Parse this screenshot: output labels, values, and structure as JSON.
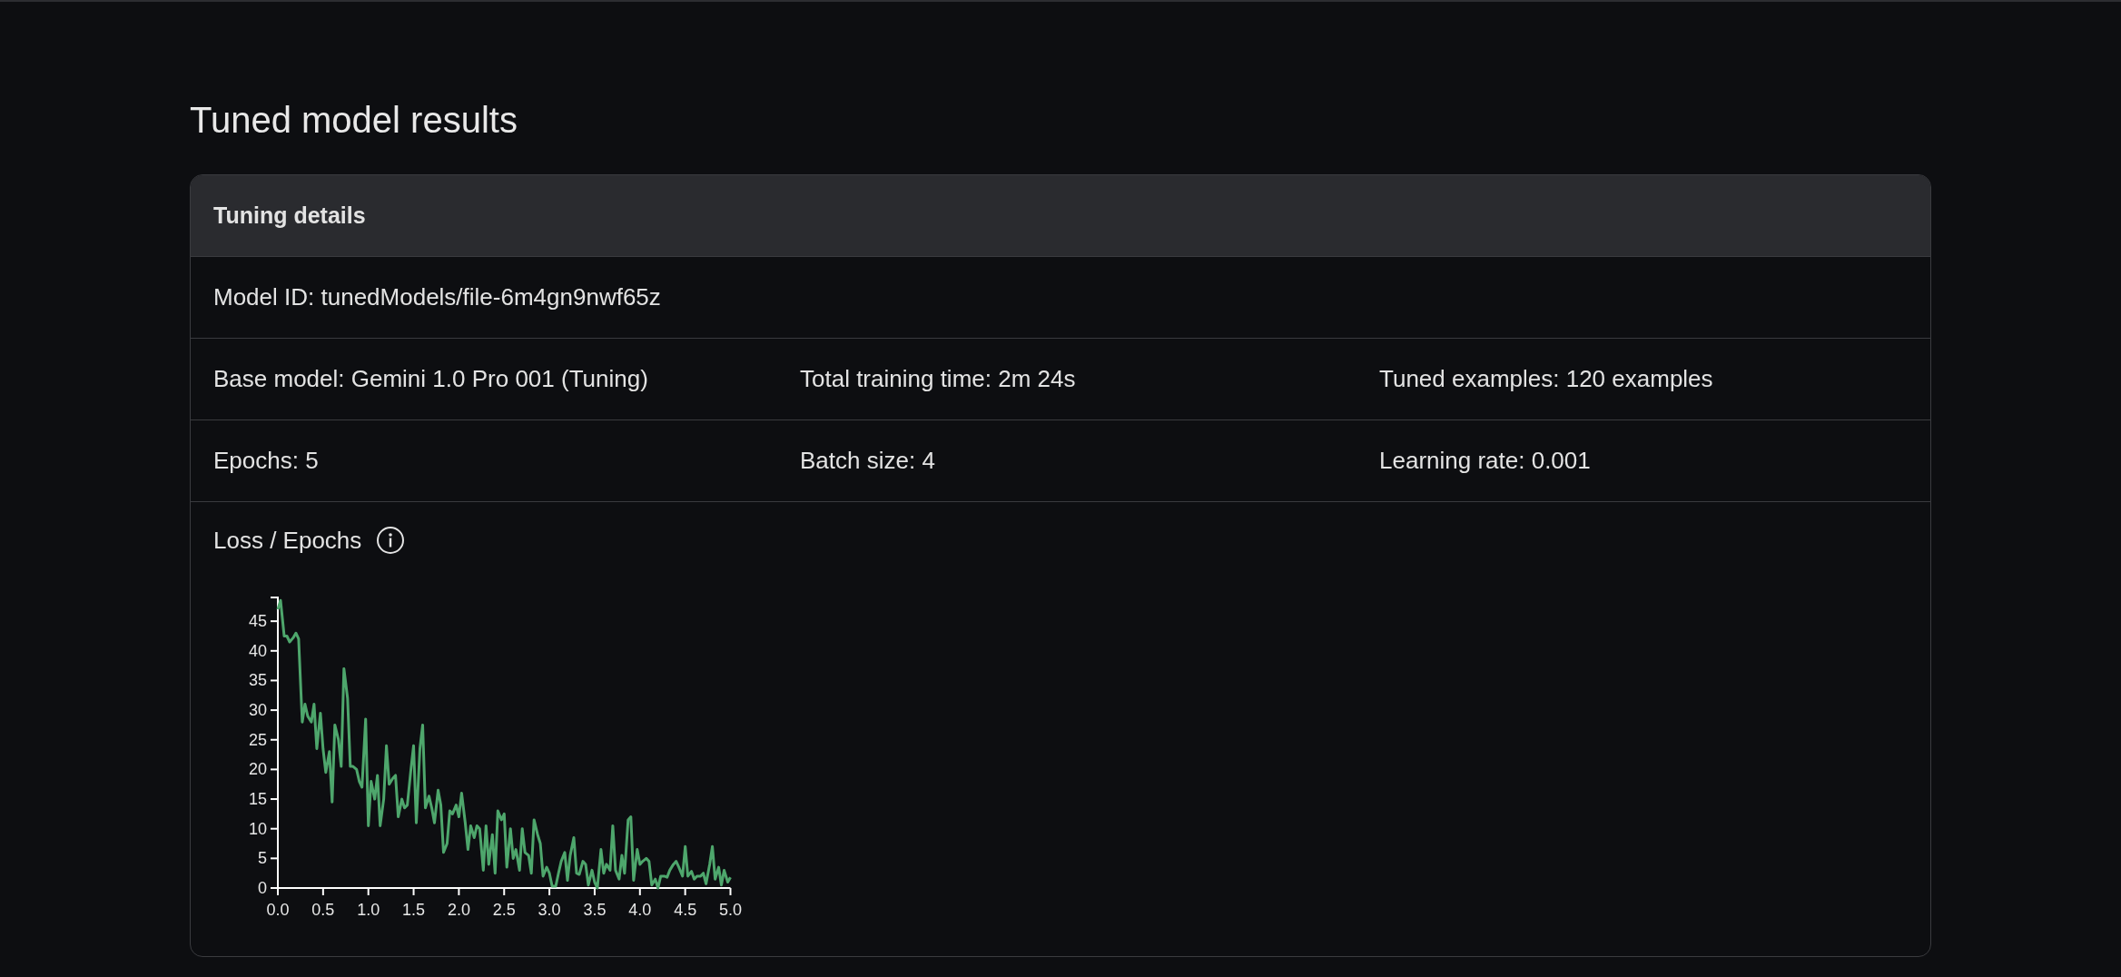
{
  "page_title": "Tuned model results",
  "card": {
    "title": "Tuning details",
    "rows": [
      [
        "Model ID: tunedModels/file-6m4gn9nwf65z"
      ],
      [
        "Base model: Gemini 1.0 Pro 001 (Tuning)",
        "Total training time: 2m 24s",
        "Tuned examples: 120 examples"
      ],
      [
        "Epochs: 5",
        "Batch size: 4",
        "Learning rate: 0.001"
      ]
    ],
    "chart_section": {
      "label": "Loss / Epochs",
      "chart_data": {
        "type": "line",
        "xlim": [
          0,
          5
        ],
        "ylim": [
          0,
          49
        ],
        "xticks": [
          {
            "value": 0,
            "label": "0.0"
          },
          {
            "value": 0.5,
            "label": "0.5"
          },
          {
            "value": 1,
            "label": "1.0"
          },
          {
            "value": 1.5,
            "label": "1.5"
          },
          {
            "value": 2,
            "label": "2.0"
          },
          {
            "value": 2.5,
            "label": "2.5"
          },
          {
            "value": 3,
            "label": "3.0"
          },
          {
            "value": 3.5,
            "label": "3.5"
          },
          {
            "value": 4,
            "label": "4.0"
          },
          {
            "value": 4.5,
            "label": "4.5"
          },
          {
            "value": 5,
            "label": "5.0"
          }
        ],
        "yticks": [
          0,
          5,
          10,
          15,
          20,
          25,
          30,
          35,
          40,
          45
        ],
        "x": [
          0,
          0.03,
          0.07,
          0.1,
          0.13,
          0.17,
          0.2,
          0.23,
          0.27,
          0.3,
          0.33,
          0.37,
          0.4,
          0.43,
          0.47,
          0.5,
          0.53,
          0.57,
          0.6,
          0.63,
          0.67,
          0.7,
          0.73,
          0.77,
          0.8,
          0.83,
          0.87,
          0.9,
          0.93,
          0.97,
          1,
          1.03,
          1.07,
          1.1,
          1.13,
          1.17,
          1.2,
          1.23,
          1.27,
          1.3,
          1.33,
          1.37,
          1.4,
          1.43,
          1.47,
          1.5,
          1.53,
          1.57,
          1.6,
          1.63,
          1.67,
          1.7,
          1.73,
          1.77,
          1.8,
          1.83,
          1.87,
          1.9,
          1.93,
          1.97,
          2,
          2.03,
          2.07,
          2.1,
          2.13,
          2.17,
          2.2,
          2.23,
          2.27,
          2.3,
          2.33,
          2.37,
          2.4,
          2.43,
          2.47,
          2.5,
          2.53,
          2.57,
          2.6,
          2.63,
          2.67,
          2.7,
          2.73,
          2.77,
          2.8,
          2.83,
          2.87,
          2.9,
          2.93,
          2.97,
          3,
          3.03,
          3.07,
          3.1,
          3.13,
          3.17,
          3.2,
          3.23,
          3.27,
          3.3,
          3.33,
          3.37,
          3.4,
          3.43,
          3.47,
          3.5,
          3.53,
          3.57,
          3.6,
          3.63,
          3.67,
          3.7,
          3.73,
          3.77,
          3.8,
          3.83,
          3.87,
          3.9,
          3.93,
          3.97,
          4,
          4.03,
          4.07,
          4.1,
          4.13,
          4.17,
          4.2,
          4.23,
          4.27,
          4.3,
          4.33,
          4.37,
          4.4,
          4.43,
          4.47,
          4.5,
          4.53,
          4.57,
          4.6,
          4.63,
          4.67,
          4.7,
          4.73,
          4.77,
          4.8,
          4.83,
          4.87,
          4.9,
          4.93,
          4.97,
          5
        ],
        "series": [
          {
            "color": "#4ea66c",
            "values": [
              47,
              48.5,
              42.5,
              42.5,
              41.5,
              42.2,
              43,
              42,
              28,
              31,
              29,
              28,
              31,
              23.5,
              29.5,
              23.5,
              19.5,
              23,
              14.5,
              27.5,
              25,
              20.5,
              37,
              32,
              20.5,
              20.5,
              20,
              18,
              17,
              28.5,
              10.5,
              18,
              15,
              19,
              10.5,
              15,
              24,
              17.5,
              18.5,
              19,
              12,
              15,
              13.5,
              14,
              20,
              24,
              11,
              23.5,
              27.5,
              13.5,
              15.5,
              13.5,
              11,
              16.5,
              14,
              6,
              7.5,
              13,
              12.5,
              14,
              12,
              16,
              11,
              6.5,
              10.5,
              8.5,
              10.5,
              10,
              3,
              10.5,
              4,
              9,
              2.5,
              13,
              11.5,
              12.5,
              3.5,
              10,
              5,
              6.5,
              3,
              10,
              6,
              5.5,
              2.5,
              11.5,
              9,
              7.5,
              2,
              3.5,
              2.5,
              0.3,
              0.3,
              2.5,
              4.5,
              6,
              1.3,
              5.5,
              8.5,
              2.5,
              2.3,
              4.5,
              4,
              0.5,
              3,
              1,
              0,
              6.5,
              2.5,
              4,
              3,
              10.5,
              3,
              1.5,
              5.5,
              2.5,
              11.5,
              12,
              1.3,
              6.5,
              4,
              4.5,
              5,
              4.5,
              0.5,
              1.5,
              0,
              2,
              2,
              1.8,
              3,
              4,
              4.5,
              3.5,
              2,
              7,
              2,
              2.8,
              1.5,
              2,
              2,
              2.5,
              0.7,
              4,
              7,
              1.5,
              3.5,
              0.5,
              3,
              1,
              1.8
            ]
          }
        ]
      }
    }
  }
}
